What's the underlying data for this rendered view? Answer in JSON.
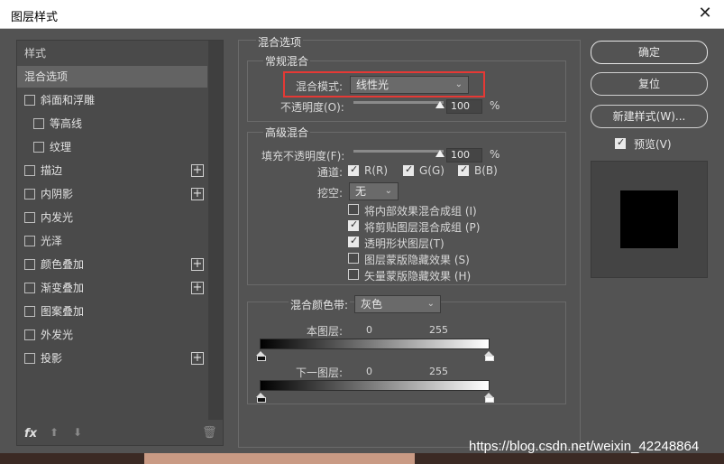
{
  "window": {
    "title": "图层样式",
    "close": "✕"
  },
  "styles_panel": {
    "header": "样式",
    "items": [
      {
        "label": "混合选项",
        "checkbox": false,
        "plus": false,
        "selected": true,
        "indent": 0
      },
      {
        "label": "斜面和浮雕",
        "checkbox": true,
        "plus": false,
        "indent": 0
      },
      {
        "label": "等高线",
        "checkbox": true,
        "plus": false,
        "indent": 1
      },
      {
        "label": "纹理",
        "checkbox": true,
        "plus": false,
        "indent": 1
      },
      {
        "label": "描边",
        "checkbox": true,
        "plus": true,
        "indent": 0
      },
      {
        "label": "内阴影",
        "checkbox": true,
        "plus": true,
        "indent": 0
      },
      {
        "label": "内发光",
        "checkbox": true,
        "plus": false,
        "indent": 0
      },
      {
        "label": "光泽",
        "checkbox": true,
        "plus": false,
        "indent": 0
      },
      {
        "label": "颜色叠加",
        "checkbox": true,
        "plus": true,
        "indent": 0
      },
      {
        "label": "渐变叠加",
        "checkbox": true,
        "plus": true,
        "indent": 0
      },
      {
        "label": "图案叠加",
        "checkbox": true,
        "plus": false,
        "indent": 0
      },
      {
        "label": "外发光",
        "checkbox": true,
        "plus": false,
        "indent": 0
      },
      {
        "label": "投影",
        "checkbox": true,
        "plus": true,
        "indent": 0
      }
    ],
    "footer": {
      "fx": "fx",
      "up": "⬆",
      "down": "⬇",
      "trash": "🗑"
    }
  },
  "blending_options": {
    "title": "混合选项",
    "general": {
      "title": "常规混合",
      "blend_mode_label": "混合模式:",
      "blend_mode_value": "线性光",
      "opacity_label": "不透明度(O):",
      "opacity_value": "100",
      "opacity_unit": "%"
    },
    "advanced": {
      "title": "高级混合",
      "fill_opacity_label": "填充不透明度(F):",
      "fill_opacity_value": "100",
      "fill_opacity_unit": "%",
      "channels_label": "通道:",
      "channel_r": "R(R)",
      "channel_g": "G(G)",
      "channel_b": "B(B)",
      "knockout_label": "挖空:",
      "knockout_value": "无",
      "options": [
        {
          "label": "将内部效果混合成组 (I)",
          "checked": false
        },
        {
          "label": "将剪贴图层混合成组 (P)",
          "checked": true
        },
        {
          "label": "透明形状图层(T)",
          "checked": true
        },
        {
          "label": "图层蒙版隐藏效果 (S)",
          "checked": false
        },
        {
          "label": "矢量蒙版隐藏效果 (H)",
          "checked": false
        }
      ]
    },
    "blend_if": {
      "label": "混合颜色带:",
      "value": "灰色",
      "this_layer_label": "本图层:",
      "this_layer_min": "0",
      "this_layer_max": "255",
      "underlying_label": "下一图层:",
      "underlying_min": "0",
      "underlying_max": "255"
    }
  },
  "buttons": {
    "ok": "确定",
    "reset": "复位",
    "new_style": "新建样式(W)...",
    "preview_label": "预览(V)"
  },
  "watermark": "https://blog.csdn.net/weixin_42248864"
}
